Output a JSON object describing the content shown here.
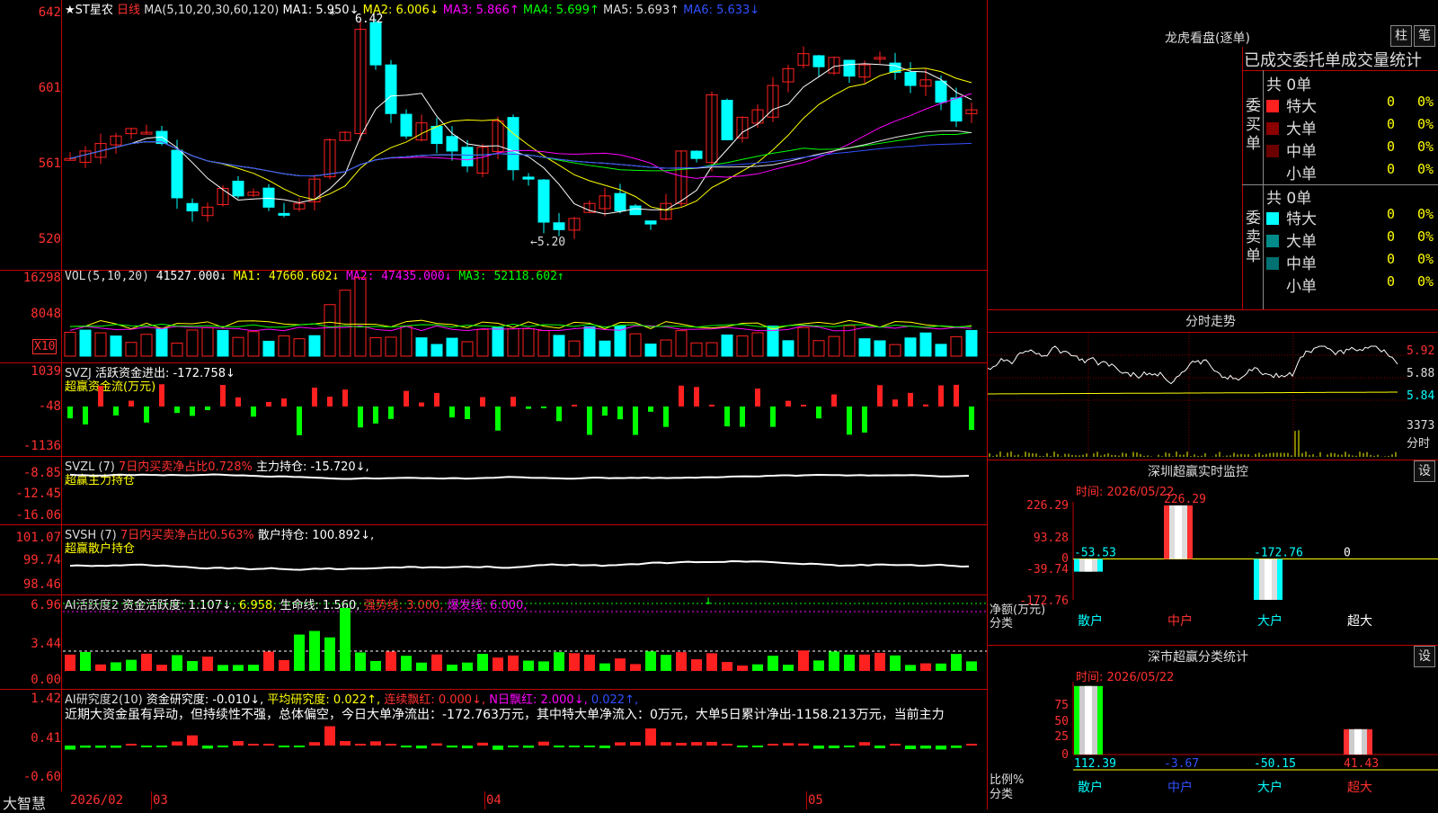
{
  "main": {
    "title": "★ST星农",
    "period": "日线",
    "ma_label": "MA(5,10,20,30,60,120)",
    "ma_values": [
      {
        "t": "MA1: 5.950↓",
        "c": "#ffffff"
      },
      {
        "t": "MA2: 6.006↓",
        "c": "#ffff00"
      },
      {
        "t": "MA3: 5.866↑",
        "c": "#ff00ff"
      },
      {
        "t": "MA4: 5.699↑",
        "c": "#00ff00"
      },
      {
        "t": "MA5: 5.693↑",
        "c": "#dddddd"
      },
      {
        "t": "MA6: 5.633↓",
        "c": "#3050ff"
      }
    ],
    "y_ticks": [
      "642",
      "601",
      "561",
      "520"
    ],
    "hi_label": "6.42",
    "lo_label": "←5.20",
    "star": "*"
  },
  "vol": {
    "legend": "VOL(5,10,20)",
    "value": "41527.000↓",
    "ma1": "MA1: 47660.602↓",
    "ma2": "MA2: 47435.000↓",
    "ma3": "MA3: 52118.602↑",
    "y_ticks": [
      "16298",
      "8048"
    ],
    "unit": "X10"
  },
  "svzj": {
    "legend": "SVZJ",
    "text": "活跃资金进出: -172.758↓",
    "sub": "超赢资金流(万元)",
    "y_ticks": [
      "1039",
      "-48",
      "-1136"
    ]
  },
  "svzl": {
    "legend": "SVZL (7)",
    "pct": "7日内买卖净占比0.728%",
    "text": "主力持仓: -15.720↓,",
    "sub": "超赢主力持仓",
    "y_ticks": [
      "-8.85",
      "-12.45",
      "-16.06"
    ]
  },
  "svsh": {
    "legend": "SVSH (7)",
    "pct": "7日内买卖净占比0.563%",
    "text": "散户持仓: 100.892↓,",
    "sub": "超赢散户持仓",
    "y_ticks": [
      "101.07",
      "99.74",
      "98.46"
    ]
  },
  "ai1": {
    "legend": "AI活跃度2",
    "a": "资金活跃度: 1.107↓,",
    "b": "6.958,",
    "c": "生命线: 1.560,",
    "d": "强势线: 3.000,",
    "e": "爆发线: 6.000,",
    "y_ticks": [
      "6.96",
      "3.44",
      "0.00"
    ],
    "arrow": "↓"
  },
  "ai2": {
    "legend": "AI研究度2(10)",
    "a": "资金研究度: -0.010↓,",
    "b": "平均研究度: 0.022↑,",
    "c": "连续飘红: 0.000↓,",
    "d": "N日飘红: 2.000↓,",
    "e": "0.022↑,",
    "comment": "近期大资金虽有异动，但持续性不强，总体偏空，今日大单净流出：-172.763万元，其中特大单净流入：0万元，大单5日累计净出-1158.213万元，当前主力",
    "y_ticks": [
      "1.42",
      "0.41",
      "-0.60"
    ]
  },
  "xaxis": {
    "brand": "大智慧",
    "labels": [
      "2026/02",
      "03",
      "04",
      "05"
    ]
  },
  "lhb": {
    "title": "龙虎看盘(逐单)",
    "btn1": "柱",
    "btn2": "笔",
    "header": "已成交委托单成交量统计",
    "buy_label": "委买单",
    "sell_label": "委卖单",
    "buy_total": "共 0单",
    "sell_total": "共 0单",
    "buy_rows": [
      {
        "name": "特大",
        "v": "0",
        "p": "0%",
        "c": "#ff2020"
      },
      {
        "name": "大单",
        "v": "0",
        "p": "0%",
        "c": "#8b0000"
      },
      {
        "name": "中单",
        "v": "0",
        "p": "0%",
        "c": "#6b0000"
      },
      {
        "name": "小单",
        "v": "0",
        "p": "0%",
        "c": "#000000"
      }
    ],
    "sell_rows": [
      {
        "name": "特大",
        "v": "0",
        "p": "0%",
        "c": "#00ffff"
      },
      {
        "name": "大单",
        "v": "0",
        "p": "0%",
        "c": "#008b8b"
      },
      {
        "name": "中单",
        "v": "0",
        "p": "0%",
        "c": "#007070"
      },
      {
        "name": "小单",
        "v": "0",
        "p": "0%",
        "c": "#000000"
      }
    ]
  },
  "intraday": {
    "title": "分时走势",
    "prices": [
      "5.92",
      "5.88",
      "5.84"
    ],
    "vol": "3373",
    "vol_unit": "分时"
  },
  "szmon": {
    "title": "深圳超赢实时监控",
    "btn": "设",
    "time": "时间: 2026/05/22",
    "y_ticks": [
      "226.29",
      "93.28",
      "0",
      "-39.74",
      "-172.76"
    ],
    "y_label": "净额(万元)",
    "x_label": "分类",
    "cats": [
      "散户",
      "中户",
      "大户",
      "超大"
    ],
    "values": [
      -53.53,
      226.29,
      -172.76,
      0
    ],
    "value_labels": [
      "-53.53",
      "226.29",
      "-172.76",
      "0"
    ]
  },
  "szcls": {
    "title": "深市超赢分类统计",
    "btn": "设",
    "time": "时间: 2026/05/22",
    "y_ticks": [
      "75",
      "50",
      "25",
      "0"
    ],
    "y_label": "比例%",
    "x_label": "分类",
    "cats": [
      "散户",
      "中户",
      "大户",
      "超大"
    ],
    "values": [
      112.39,
      -3.67,
      -50.15,
      41.43
    ],
    "value_labels": [
      "112.39",
      "-3.67",
      "-50.15",
      "41.43"
    ]
  }
}
